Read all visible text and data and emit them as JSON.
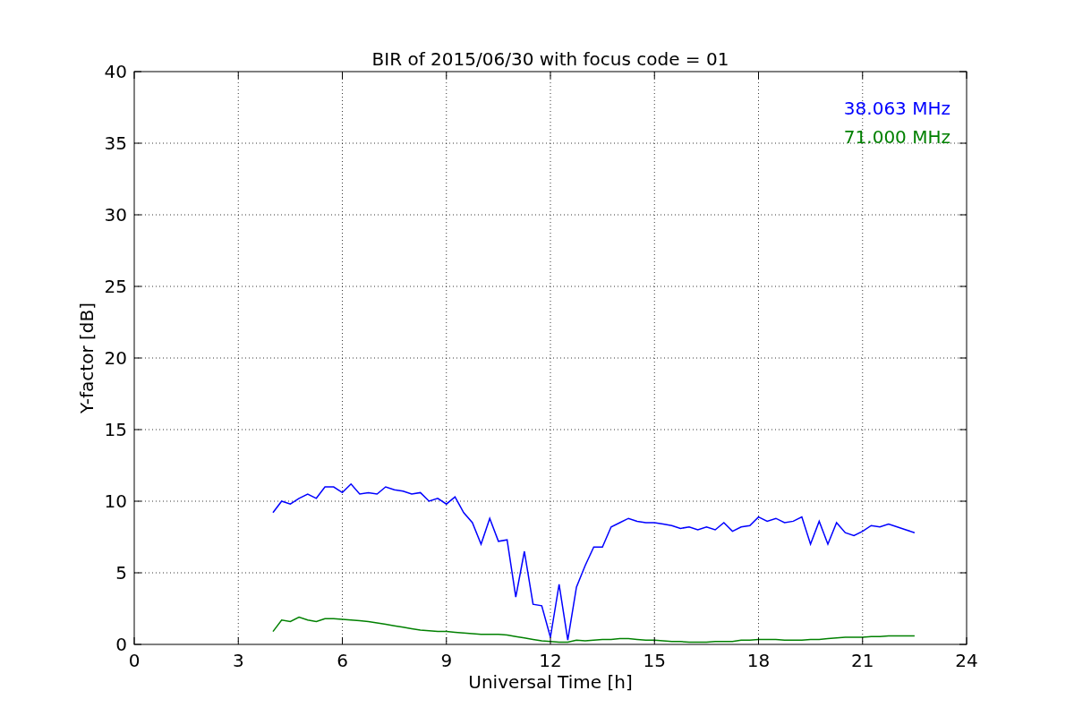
{
  "chart_data": {
    "type": "line",
    "title": "BIR of 2015/06/30 with focus code = 01",
    "xlabel": "Universal Time [h]",
    "ylabel": "Y-factor [dB]",
    "x": [
      4.0,
      4.25,
      4.5,
      4.75,
      5.0,
      5.25,
      5.5,
      5.75,
      6.0,
      6.25,
      6.5,
      6.75,
      7.0,
      7.25,
      7.5,
      7.75,
      8.0,
      8.25,
      8.5,
      8.75,
      9.0,
      9.25,
      9.5,
      9.75,
      10.0,
      10.25,
      10.5,
      10.75,
      11.0,
      11.25,
      11.5,
      11.75,
      12.0,
      12.25,
      12.5,
      12.75,
      13.0,
      13.25,
      13.5,
      13.75,
      14.0,
      14.25,
      14.5,
      14.75,
      15.0,
      15.25,
      15.5,
      15.75,
      16.0,
      16.25,
      16.5,
      16.75,
      17.0,
      17.25,
      17.5,
      17.75,
      18.0,
      18.25,
      18.5,
      18.75,
      19.0,
      19.25,
      19.5,
      19.75,
      20.0,
      20.25,
      20.5,
      20.75,
      21.0,
      21.25,
      21.5,
      21.75,
      22.0,
      22.25,
      22.5
    ],
    "series": [
      {
        "name": "38.063 MHz",
        "color": "#0000ff",
        "values": [
          9.2,
          10.0,
          9.8,
          10.2,
          10.5,
          10.2,
          11.0,
          11.0,
          10.6,
          11.2,
          10.5,
          10.6,
          10.5,
          11.0,
          10.8,
          10.7,
          10.5,
          10.6,
          10.0,
          10.2,
          9.8,
          10.3,
          9.2,
          8.5,
          7.0,
          8.8,
          7.2,
          7.3,
          3.3,
          6.5,
          2.8,
          2.7,
          0.5,
          4.2,
          0.3,
          4.0,
          5.5,
          6.8,
          6.8,
          8.2,
          8.5,
          8.8,
          8.6,
          8.5,
          8.5,
          8.4,
          8.3,
          8.1,
          8.2,
          8.0,
          8.2,
          8.0,
          8.5,
          7.9,
          8.2,
          8.3,
          8.9,
          8.6,
          8.8,
          8.5,
          8.6,
          8.9,
          7.0,
          8.6,
          7.0,
          8.5,
          7.8,
          7.6,
          7.9,
          8.3,
          8.2,
          8.4,
          8.2,
          8.0,
          7.8
        ]
      },
      {
        "name": "71.000 MHz",
        "color": "#008000",
        "values": [
          0.9,
          1.7,
          1.6,
          1.9,
          1.7,
          1.6,
          1.8,
          1.8,
          1.75,
          1.7,
          1.65,
          1.6,
          1.5,
          1.4,
          1.3,
          1.2,
          1.1,
          1.0,
          0.95,
          0.9,
          0.9,
          0.85,
          0.8,
          0.75,
          0.7,
          0.7,
          0.7,
          0.65,
          0.55,
          0.45,
          0.35,
          0.25,
          0.2,
          0.15,
          0.15,
          0.3,
          0.25,
          0.3,
          0.35,
          0.35,
          0.4,
          0.4,
          0.35,
          0.3,
          0.3,
          0.25,
          0.2,
          0.2,
          0.15,
          0.15,
          0.15,
          0.2,
          0.2,
          0.2,
          0.3,
          0.3,
          0.35,
          0.35,
          0.35,
          0.3,
          0.3,
          0.3,
          0.35,
          0.35,
          0.4,
          0.45,
          0.5,
          0.5,
          0.5,
          0.55,
          0.55,
          0.6,
          0.6,
          0.6,
          0.6
        ]
      }
    ],
    "grid": true,
    "xlim": [
      0,
      24
    ],
    "ylim": [
      0,
      40
    ],
    "xticks": [
      0,
      3,
      6,
      9,
      12,
      15,
      18,
      21,
      24
    ],
    "yticks": [
      0,
      5,
      10,
      15,
      20,
      25,
      30,
      35,
      40
    ]
  }
}
